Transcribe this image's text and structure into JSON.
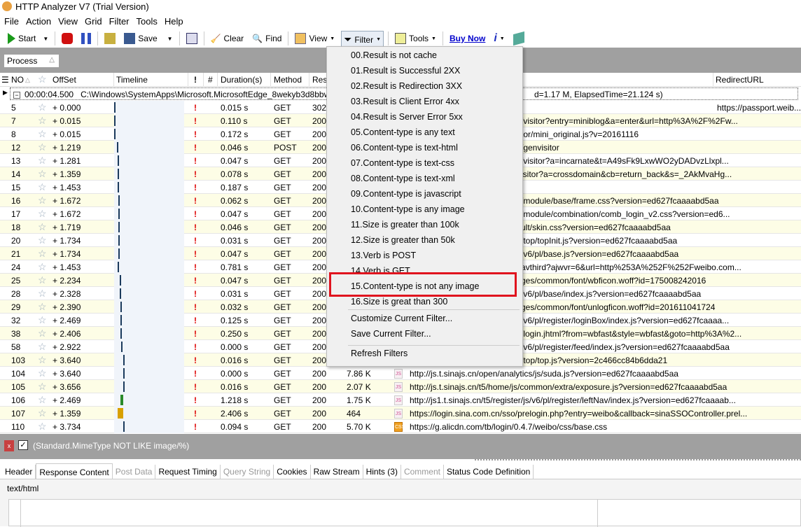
{
  "window": {
    "title": "HTTP Analyzer V7  (Trial Version)",
    "icon": "W7"
  },
  "menubar": [
    "File",
    "Action",
    "View",
    "Grid",
    "Filter",
    "Tools",
    "Help"
  ],
  "toolbar": {
    "start": "Start",
    "save": "Save",
    "clear": "Clear",
    "find": "Find",
    "view": "View",
    "filter": "Filter",
    "tools": "Tools",
    "buy_now": "Buy Now",
    "info": "i"
  },
  "process_box": "Process",
  "columns": {
    "no": "NO",
    "offset": "OffSet",
    "timeline": "Timeline",
    "flag": "!",
    "hash": "#",
    "duration": "Duration(s)",
    "method": "Method",
    "result": "Res",
    "redirect": "RedirectURL"
  },
  "group_row": {
    "time": "00:00:04.500",
    "path": "C:\\Windows\\SystemApps\\Microsoft.MicrosoftEdge_8wekyb3d8bbwe\\Micro",
    "tail": "d=1.17 M, ElapsedTime=21.124 s)"
  },
  "rows": [
    {
      "no": "5",
      "offset": "+ 0.000",
      "duration": "0.015 s",
      "method": "GET",
      "result": "302",
      "size": "",
      "type": "",
      "url": "",
      "redirect": "https://passport.weib...",
      "tl": 0
    },
    {
      "no": "7",
      "offset": "+ 0.015",
      "duration": "0.110 s",
      "method": "GET",
      "result": "200",
      "url": "/visitor?entry=miniblog&a=enter&url=http%3A%2F%2Fw...",
      "tl": 0
    },
    {
      "no": "8",
      "offset": "+ 0.015",
      "duration": "0.172 s",
      "method": "GET",
      "result": "200",
      "url": "tor/mini_original.js?v=20161116",
      "tl": 0
    },
    {
      "no": "12",
      "offset": "+ 1.219",
      "duration": "0.046 s",
      "method": "POST",
      "result": "200",
      "url": "/genvisitor",
      "tl": 1.2
    },
    {
      "no": "13",
      "offset": "+ 1.281",
      "duration": "0.047 s",
      "method": "GET",
      "result": "200",
      "url": "/visitor?a=incarnate&t=A49sFk9LxwWO2yDADvzLlxpl...",
      "tl": 1.3
    },
    {
      "no": "14",
      "offset": "+ 1.359",
      "duration": "0.078 s",
      "method": "GET",
      "result": "200",
      "url": "isitor?a=crossdomain&cb=return_back&s=_2AkMvaHg...",
      "tl": 1.4
    },
    {
      "no": "15",
      "offset": "+ 1.453",
      "duration": "0.187 s",
      "method": "GET",
      "result": "200",
      "url": "",
      "tl": 1.5
    },
    {
      "no": "16",
      "offset": "+ 1.672",
      "duration": "0.062 s",
      "method": "GET",
      "result": "200",
      "url": "/module/base/frame.css?version=ed627fcaaaabd5aa",
      "tl": 1.7
    },
    {
      "no": "17",
      "offset": "+ 1.672",
      "duration": "0.047 s",
      "method": "GET",
      "result": "200",
      "url": "/module/combination/comb_login_v2.css?version=ed6...",
      "tl": 1.7
    },
    {
      "no": "18",
      "offset": "+ 1.719",
      "duration": "0.046 s",
      "method": "GET",
      "result": "200",
      "url": "ult/skin.css?version=ed627fcaaaabd5aa",
      "tl": 1.7
    },
    {
      "no": "20",
      "offset": "+ 1.734",
      "duration": "0.031 s",
      "method": "GET",
      "result": "200",
      "url": "/top/topInit.js?version=ed627fcaaaabd5aa",
      "tl": 1.7
    },
    {
      "no": "21",
      "offset": "+ 1.734",
      "duration": "0.047 s",
      "method": "GET",
      "result": "200",
      "url": "/v6/pl/base.js?version=ed627fcaaaabd5aa",
      "tl": 1.7
    },
    {
      "no": "24",
      "offset": "+ 1.453",
      "duration": "0.781 s",
      "method": "GET",
      "result": "200",
      "url": "avthird?ajwvr=6&url=http%253A%252F%252Fweibo.com...",
      "tl": 1.5
    },
    {
      "no": "25",
      "offset": "+ 2.234",
      "duration": "0.047 s",
      "method": "GET",
      "result": "200",
      "url": "ges/common/font/wbficon.woff?id=175008242016",
      "tl": 2.2
    },
    {
      "no": "28",
      "offset": "+ 2.328",
      "duration": "0.031 s",
      "method": "GET",
      "result": "200",
      "url": "/v6/pl/base/index.js?version=ed627fcaaaabd5aa",
      "tl": 2.3
    },
    {
      "no": "29",
      "offset": "+ 2.390",
      "duration": "0.032 s",
      "method": "GET",
      "result": "200",
      "url": "ges/common/font/unlogficon.woff?id=201611041724",
      "tl": 2.4
    },
    {
      "no": "32",
      "offset": "+ 2.469",
      "duration": "0.125 s",
      "method": "GET",
      "result": "200",
      "url": "/v6/pl/register/loginBox/index.js?version=ed627fcaaaa...",
      "tl": 2.5
    },
    {
      "no": "38",
      "offset": "+ 2.406",
      "duration": "0.250 s",
      "method": "GET",
      "result": "200",
      "url": "/login.jhtml?from=wbfast&style=wbfast&goto=http%3A%2...",
      "tl": 2.4
    },
    {
      "no": "58",
      "offset": "+ 2.922",
      "duration": "0.000 s",
      "method": "GET",
      "result": "200",
      "url": "/v6/pl/register/feed/index.js?version=ed627fcaaaabd5aa",
      "tl": 2.9
    },
    {
      "no": "103",
      "offset": "+ 3.640",
      "duration": "0.016 s",
      "method": "GET",
      "result": "200",
      "url": "/top/top.js?version=2c466cc84b6dda21",
      "tl": 3.6
    },
    {
      "no": "104",
      "offset": "+ 3.640",
      "duration": "0.000 s",
      "method": "GET",
      "result": "200",
      "size": "7.86 K",
      "type": "js",
      "url": "http://js.t.sinajs.cn/open/analytics/js/suda.js?version=ed627fcaaaabd5aa",
      "tl": 3.6
    },
    {
      "no": "105",
      "offset": "+ 3.656",
      "duration": "0.016 s",
      "method": "GET",
      "result": "200",
      "size": "2.07 K",
      "type": "js",
      "url": "http://js.t.sinajs.cn/t5/home/js/common/extra/exposure.js?version=ed627fcaaaabd5aa",
      "tl": 3.6
    },
    {
      "no": "106",
      "offset": "+ 2.469",
      "duration": "1.218 s",
      "method": "GET",
      "result": "200",
      "size": "1.75 K",
      "type": "js",
      "url": "http://js1.t.sinajs.cn/t5/register/js/v6/pl/register/leftNav/index.js?version=ed627fcaaaab...",
      "tl": 2.5
    },
    {
      "no": "107",
      "offset": "+ 1.359",
      "duration": "2.406 s",
      "method": "GET",
      "result": "200",
      "size": "464",
      "type": "js",
      "url": "https://login.sina.com.cn/sso/prelogin.php?entry=weibo&callback=sinaSSOController.prel...",
      "tl": 1.4
    },
    {
      "no": "110",
      "offset": "+ 3.734",
      "duration": "0.094 s",
      "method": "GET",
      "result": "200",
      "size": "5.70 K",
      "type": "css",
      "url": "https://g.alicdn.com/tb/login/0.4.7/weibo/css/base.css",
      "tl": 3.7
    }
  ],
  "filter_menu": {
    "items": [
      "00.Result is not cache",
      "01.Result is Successful 2XX",
      "02.Result is Redirection 3XX",
      "03.Result is Client Error 4xx",
      "04.Result is Server Error 5xx",
      "05.Content-type is any text",
      "06.Content-type is text-html",
      "07.Content-type is text-css",
      "08.Content-type is text-xml",
      "09.Content-type is javascript",
      "10.Content-type is any image",
      "11.Size is greater than 100k",
      "12.Size is greater than 50k",
      "13.Verb is POST",
      "14.Verb is GET",
      "15.Content-type is not any image",
      "16.Size is great than 300"
    ],
    "highlighted": "15.Content-type is not any image",
    "customize": "Customize Current Filter...",
    "save": "Save Current Filter...",
    "refresh": "Refresh Filters"
  },
  "filter_bar": {
    "expression": "(Standard.MimeType  NOT LIKE image/%)",
    "enabled": true
  },
  "tabs": [
    {
      "label": "Header"
    },
    {
      "label": "Response Content",
      "active": true
    },
    {
      "label": "Post Data",
      "disabled": true
    },
    {
      "label": "Request Timing"
    },
    {
      "label": "Query String",
      "disabled": true
    },
    {
      "label": "Cookies"
    },
    {
      "label": "Raw Stream"
    },
    {
      "label": "Hints (3)"
    },
    {
      "label": "Comment",
      "disabled": true
    },
    {
      "label": "Status Code Definition"
    }
  ],
  "content": {
    "mime": "text/html"
  },
  "colors": {
    "highlight_box": "#e0141e",
    "row_alt": "#fdfde6",
    "buy_now": "#0000cc",
    "flag": "#dd0000"
  }
}
